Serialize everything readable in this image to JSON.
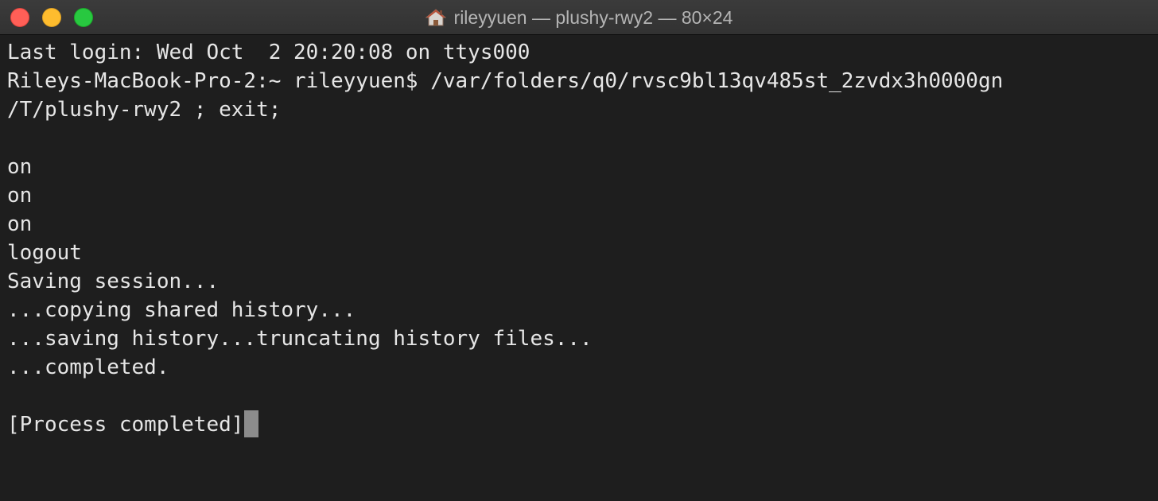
{
  "window": {
    "title": "rileyyuen — plushy-rwy2 — 80×24",
    "title_icon": "home-icon",
    "controls": [
      "close",
      "minimize",
      "zoom"
    ]
  },
  "colors": {
    "background": "#1e1e1e",
    "text": "#e6e6e6",
    "cursor": "#8c8c8c",
    "close": "#ff5f57",
    "minimize": "#febc2e",
    "zoom": "#28c840"
  },
  "terminal": {
    "lines": [
      "Last login: Wed Oct  2 20:20:08 on ttys000",
      "Rileys-MacBook-Pro-2:~ rileyyuen$ /var/folders/q0/rvsc9bl13qv485st_2zvdx3h0000gn",
      "/T/plushy-rwy2 ; exit;",
      "",
      "on",
      "on",
      "on",
      "logout",
      "Saving session...",
      "...copying shared history...",
      "...saving history...truncating history files...",
      "...completed.",
      "",
      "[Process completed]"
    ]
  }
}
